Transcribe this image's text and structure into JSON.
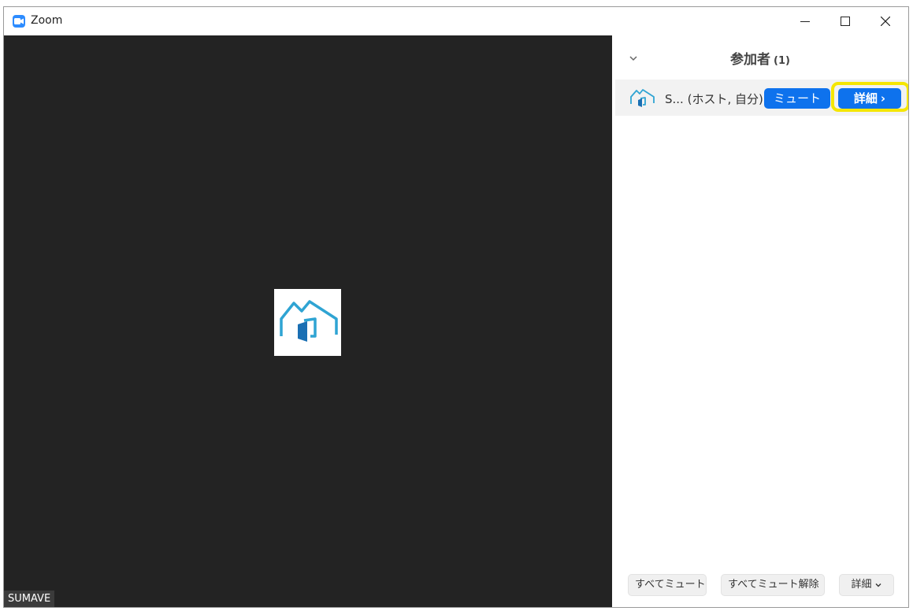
{
  "window": {
    "title": "Zoom",
    "app_icon": "zoom-camera-icon",
    "controls": [
      "minimize-icon",
      "maximize-icon",
      "close-icon"
    ]
  },
  "video": {
    "participant_name_tag": "SUMAVE",
    "avatar_icon": "house-logo-icon",
    "background_color": "#232323"
  },
  "participants_panel": {
    "title": "参加者",
    "count": "(1)",
    "collapse_icon": "chevron-down-icon",
    "participants": [
      {
        "name": "S... (ホスト, 自分)",
        "avatar_icon": "house-logo-icon",
        "mute_label": "ミュート",
        "more_label": "詳細",
        "more_icon": "chevron-right-icon"
      }
    ],
    "footer": {
      "mute_all_label": "すべてミュート",
      "unmute_all_label": "すべてミュート解除",
      "more_label": "詳細"
    }
  },
  "colors": {
    "accent_blue": "#0E72ED",
    "highlight_yellow": "#F5E600",
    "zoom_brand": "#2D8CFF"
  }
}
